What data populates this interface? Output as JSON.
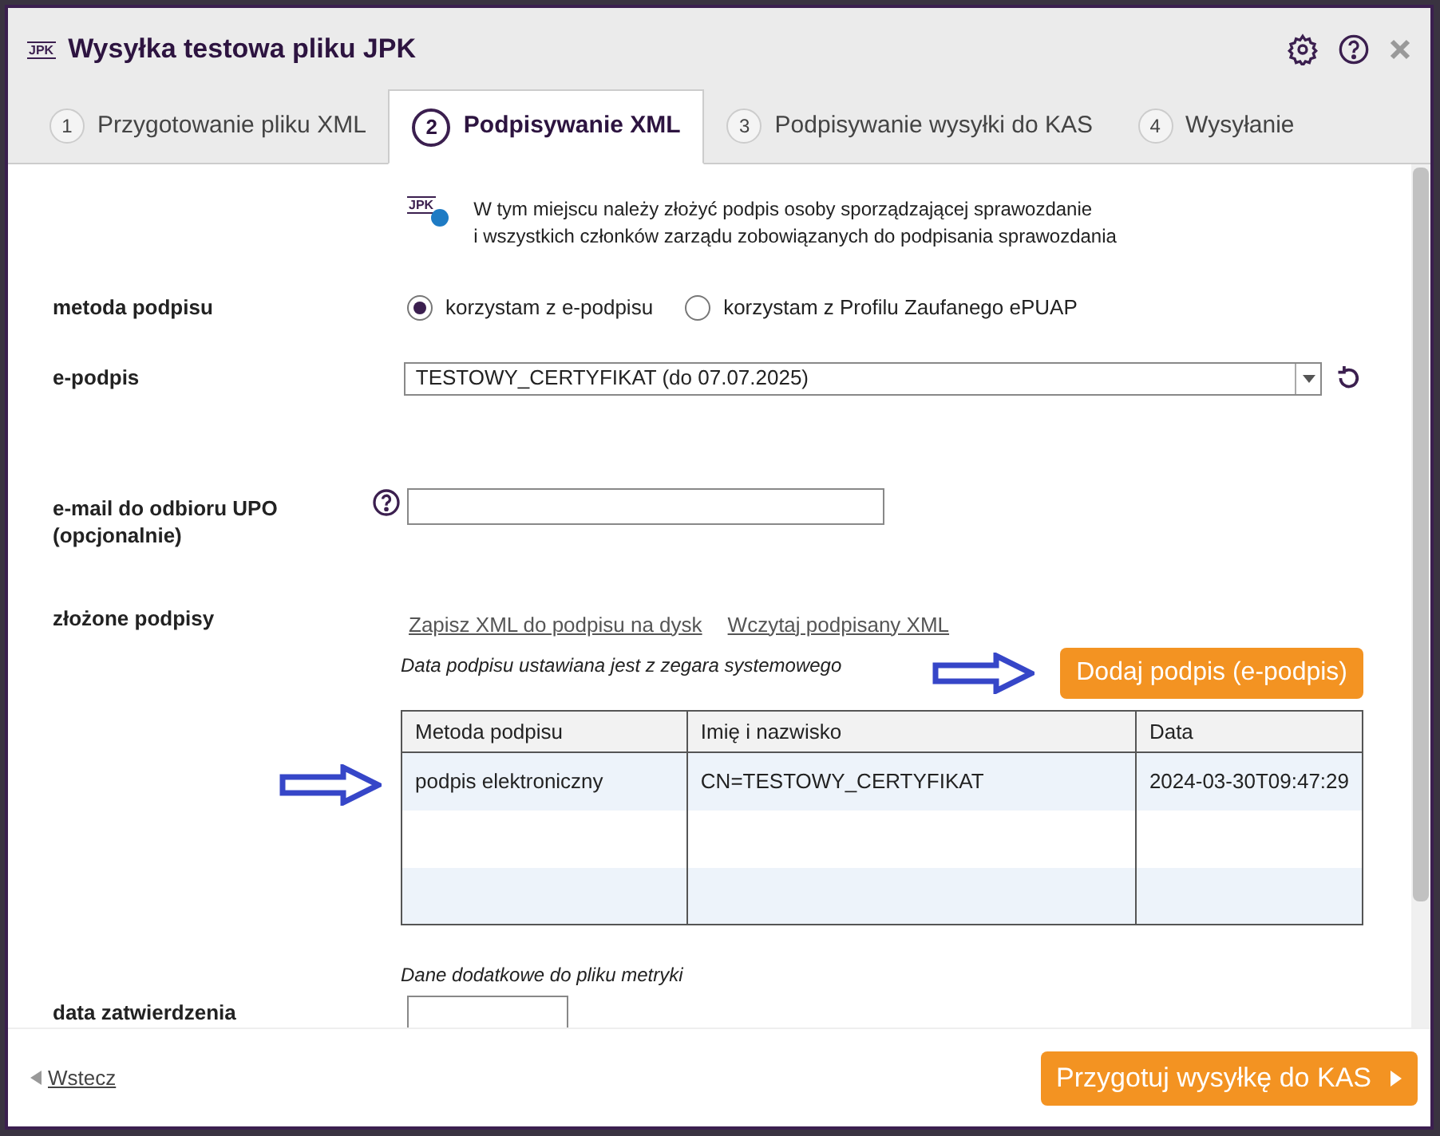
{
  "window": {
    "logo": "JPK",
    "title": "Wysyłka testowa pliku JPK"
  },
  "tabs": [
    {
      "number": "1",
      "label": "Przygotowanie pliku XML",
      "selected": false
    },
    {
      "number": "2",
      "label": "Podpisywanie XML",
      "selected": true
    },
    {
      "number": "3",
      "label": "Podpisywanie wysyłki do KAS",
      "selected": false
    },
    {
      "number": "4",
      "label": "Wysyłanie",
      "selected": false
    }
  ],
  "info": {
    "logo": "JPK",
    "lines": [
      "W tym miejscu należy złożyć podpis osoby sporządzającej sprawozdanie",
      "i wszystkich członków zarządu zobowiązanych do podpisania sprawozdania"
    ]
  },
  "signature_method": {
    "label": "metoda podpisu",
    "options": [
      {
        "label": "korzystam z e-podpisu",
        "selected": true
      },
      {
        "label": "korzystam z Profilu Zaufanego ePUAP",
        "selected": false
      }
    ]
  },
  "e_signature": {
    "label": "e-podpis",
    "value": "TESTOWY_CERTYFIKAT (do 07.07.2025)"
  },
  "email": {
    "label": "e-mail do odbioru UPO",
    "sublabel": "(opcjonalnie)"
  },
  "signatures": {
    "label": "złożone podpisy",
    "links": [
      "Zapisz XML do podpisu na dysk",
      "Wczytaj podpisany XML"
    ],
    "note": "Data podpisu ustawiana jest z zegara systemowego",
    "add_button": "Dodaj podpis (e-podpis)",
    "columns": [
      "Metoda podpisu",
      "Imię i nazwisko",
      "Data"
    ],
    "rows": [
      [
        "podpis elektroniczny",
        "CN=TESTOWY_CERTYFIKAT",
        "2024-03-30T09:47:29"
      ]
    ]
  },
  "metadata": {
    "note": "Dane dodatkowe do pliku metryki",
    "approval_label": "data zatwierdzenia"
  },
  "footer": {
    "back": "Wstecz",
    "next": "Przygotuj wysyłkę do KAS"
  }
}
